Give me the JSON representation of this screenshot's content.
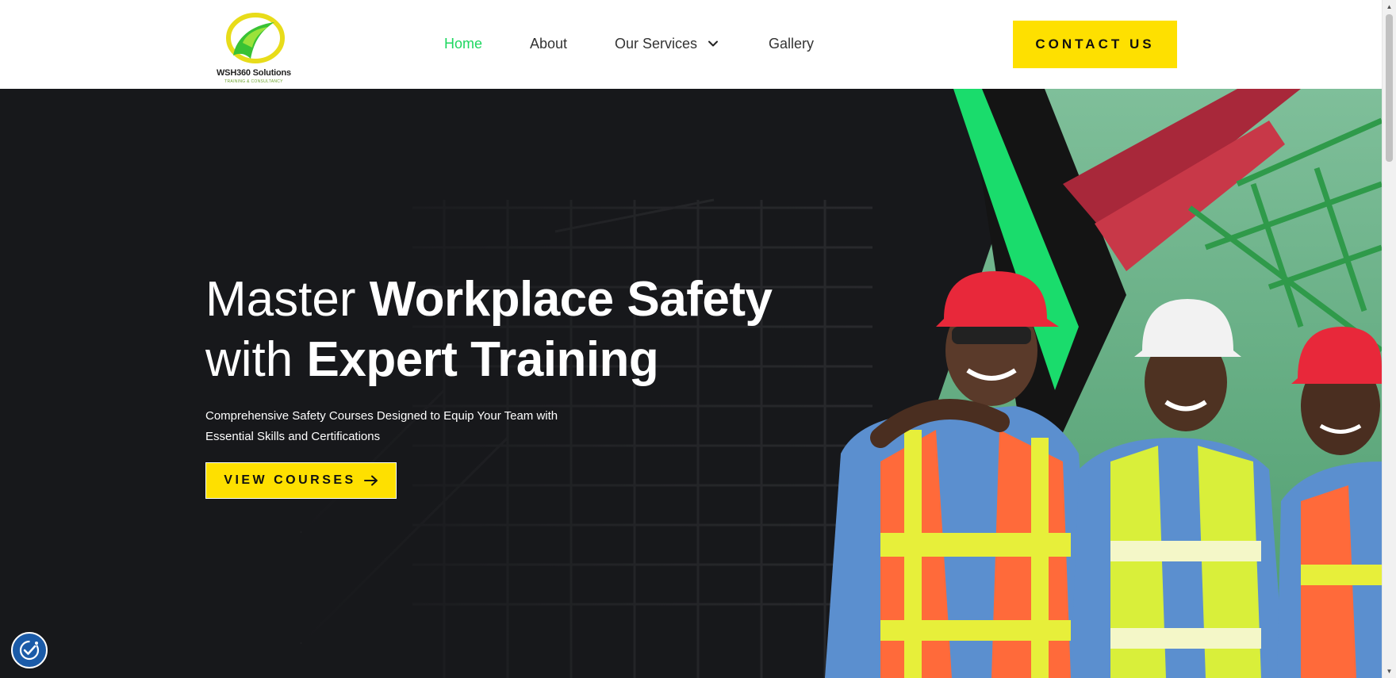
{
  "brand": {
    "name": "WSH360 Solutions",
    "tagline": "TRAINING & CONSULTANCY"
  },
  "nav": {
    "items": [
      {
        "label": "Home",
        "active": true
      },
      {
        "label": "About",
        "active": false
      },
      {
        "label": "Our Services",
        "active": false
      },
      {
        "label": "Gallery",
        "active": false
      }
    ],
    "dropdown_icon": "chevron-down-icon"
  },
  "header": {
    "contact_label": "CONTACT US"
  },
  "hero": {
    "title_line1_light": "Master ",
    "title_line1_bold": "Workplace Safety",
    "title_line2_light": "with ",
    "title_line2_bold": "Expert Training",
    "subtitle": "Comprehensive Safety Courses Designed to Equip Your Team with Essential Skills and Certifications",
    "cta_label": "VIEW COURSES",
    "cta_icon": "arrow-right-icon"
  },
  "accessibility": {
    "icon": "accessibility-icon"
  },
  "colors": {
    "accent_green": "#1ed760",
    "accent_yellow": "#fee000",
    "hero_bg": "#17181b",
    "accessibility_blue": "#1b5ba8"
  }
}
